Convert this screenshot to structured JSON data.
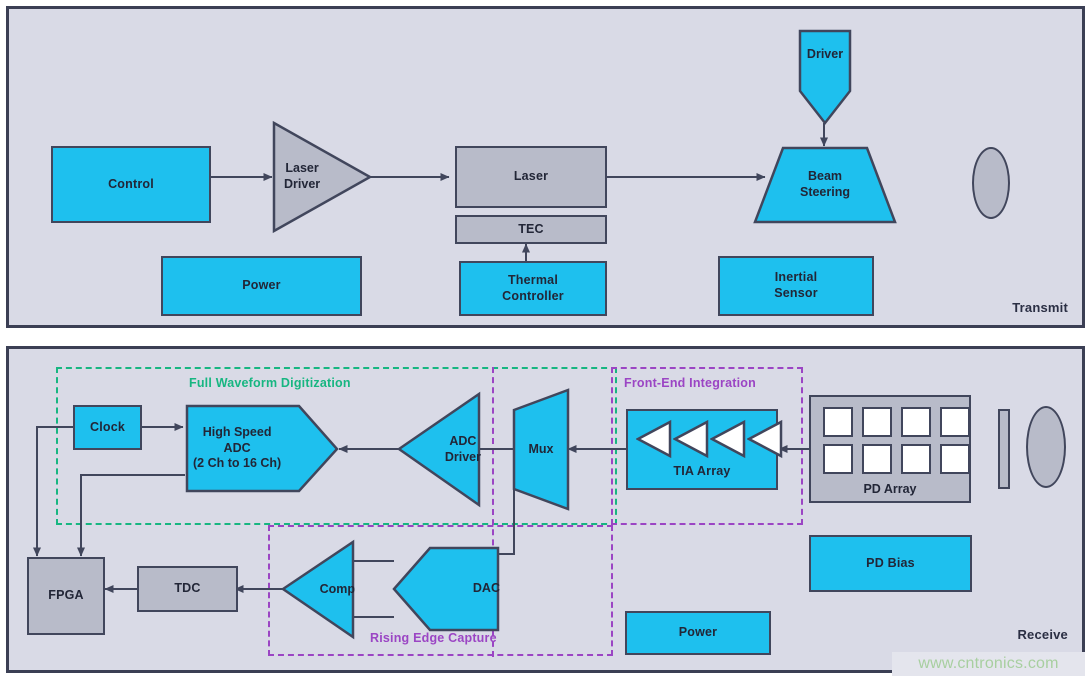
{
  "colors": {
    "cyan": "#1ec0ee",
    "gray": "#b8bbc9",
    "panel_bg": "#d9dae6",
    "stroke": "#41465c",
    "green_dash": "#17b681",
    "purple_dash": "#9b45c4",
    "watermark_text": "#a8cfa0"
  },
  "transmit": {
    "panel_label": "Transmit",
    "blocks": {
      "control": "Control",
      "laser_driver": "Laser\nDriver",
      "laser_driver_line1": "Laser",
      "laser_driver_line2": "Driver",
      "laser": "Laser",
      "tec": "TEC",
      "driver": "Driver",
      "beam_steering_line1": "Beam",
      "beam_steering_line2": "Steering",
      "power": "Power",
      "thermal_controller_line1": "Thermal",
      "thermal_controller_line2": "Controller",
      "inertial_sensor_line1": "Inertial",
      "inertial_sensor_line2": "Sensor",
      "tx_lens": ""
    }
  },
  "receive": {
    "panel_label": "Receive",
    "groups": {
      "full_waveform": "Full Waveform Digitization",
      "front_end": "Front-End Integration",
      "rising_edge": "Rising Edge Capture"
    },
    "blocks": {
      "clock": "Clock",
      "adc_line1": "High Speed",
      "adc_line2": "ADC",
      "adc_line3": "(2 Ch to 16 Ch)",
      "adc_driver_line1": "ADC",
      "adc_driver_line2": "Driver",
      "mux": "Mux",
      "tia_array": "TIA Array",
      "pd_array": "PD Array",
      "pd_bias": "PD Bias",
      "power": "Power",
      "fpga": "FPGA",
      "tdc": "TDC",
      "comp": "Comp",
      "dac": "DAC",
      "rx_filter": "",
      "rx_lens": ""
    },
    "pd_cells": [
      "pd-1",
      "pd-2",
      "pd-3",
      "pd-4",
      "pd-5",
      "pd-6",
      "pd-7",
      "pd-8"
    ],
    "tia_amps": [
      "tia-amp-1",
      "tia-amp-2",
      "tia-amp-3",
      "tia-amp-4"
    ]
  },
  "watermark": {
    "text": "www.cntronics.com"
  }
}
